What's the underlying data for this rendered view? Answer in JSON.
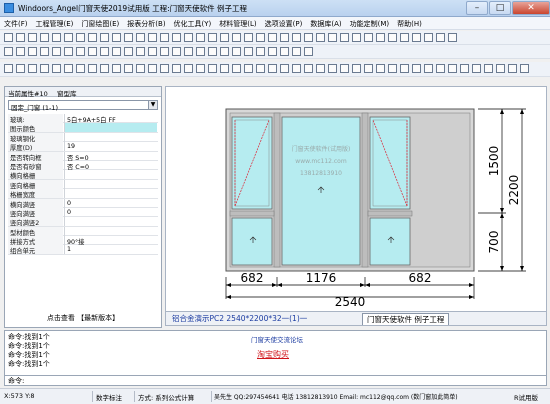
{
  "window": {
    "title": "Windoors_Angel门窗天使2019试用版 工程:门窗天使软件 例子工程"
  },
  "menu": [
    "文件(F)",
    "工程管理(E)",
    "门窗绘图(E)",
    "报表分析(B)",
    "优化工具(Y)",
    "材料管理(L)",
    "选项设置(P)",
    "数据库(A)",
    "功能定制(M)",
    "帮助(H)"
  ],
  "left_panel": {
    "tabs": [
      "当前属性#10",
      "窗型库"
    ],
    "selector": "固定_门窗 (1-1)",
    "properties": [
      {
        "k": "玻璃:",
        "v": "5白+9A+5白 FF"
      },
      {
        "k": "图示颜色",
        "v": ""
      },
      {
        "k": "玻璃钢化",
        "v": ""
      },
      {
        "k": "厚度(D)",
        "v": "19"
      },
      {
        "k": "是否转向框",
        "v": "否 S=0"
      },
      {
        "k": "是否有砂窗",
        "v": "否 C=0"
      },
      {
        "k": "横向格栅",
        "v": ""
      },
      {
        "k": "竖向格栅",
        "v": ""
      },
      {
        "k": "格栅宽度",
        "v": ""
      },
      {
        "k": "横向满竖",
        "v": "0"
      },
      {
        "k": "竖向满竖",
        "v": "0"
      },
      {
        "k": "竖向满竖2",
        "v": ""
      },
      {
        "k": "型材颜色",
        "v": ""
      },
      {
        "k": "拼接方式",
        "v": "90°接"
      },
      {
        "k": "组合单元",
        "v": "1"
      }
    ],
    "bottom_link": "点击查看 【最新版本】"
  },
  "drawing": {
    "dim_bottom": [
      "682",
      "1176",
      "682"
    ],
    "dim_total": "2540",
    "dim_right": [
      "1500",
      "700"
    ],
    "dim_right_total": "2200",
    "watermark": [
      "门窗天使软件(试用版)",
      "www.mc112.com",
      "13812813910"
    ]
  },
  "doc_tabs": [
    {
      "label": "铝合金演示PC2 2540*2200*32一(1)一"
    },
    {
      "label": "门窗天使软件 例子工程"
    }
  ],
  "output": {
    "lines": [
      "命令:找到1个",
      "命令:找到1个",
      "命令:找到1个",
      "命令:找到1个"
    ],
    "forum": "门窗天使交流论坛",
    "shop": "淘宝购买",
    "command_prompt": "命令:"
  },
  "status": {
    "coords": "X:573  Y:8",
    "mode": "数字标注",
    "method": "方式: 系列公式计算",
    "contact": "吴先生 QQ:297454641 电话 13812813910 Email: mc112@qq.com (数门窗加此简单)",
    "edition": "R试用版"
  },
  "colors": {
    "glass": "#b6ecf0",
    "frame": "#8a8a8a",
    "dim": "#000000",
    "panel_bg": "#f0f0f0"
  }
}
